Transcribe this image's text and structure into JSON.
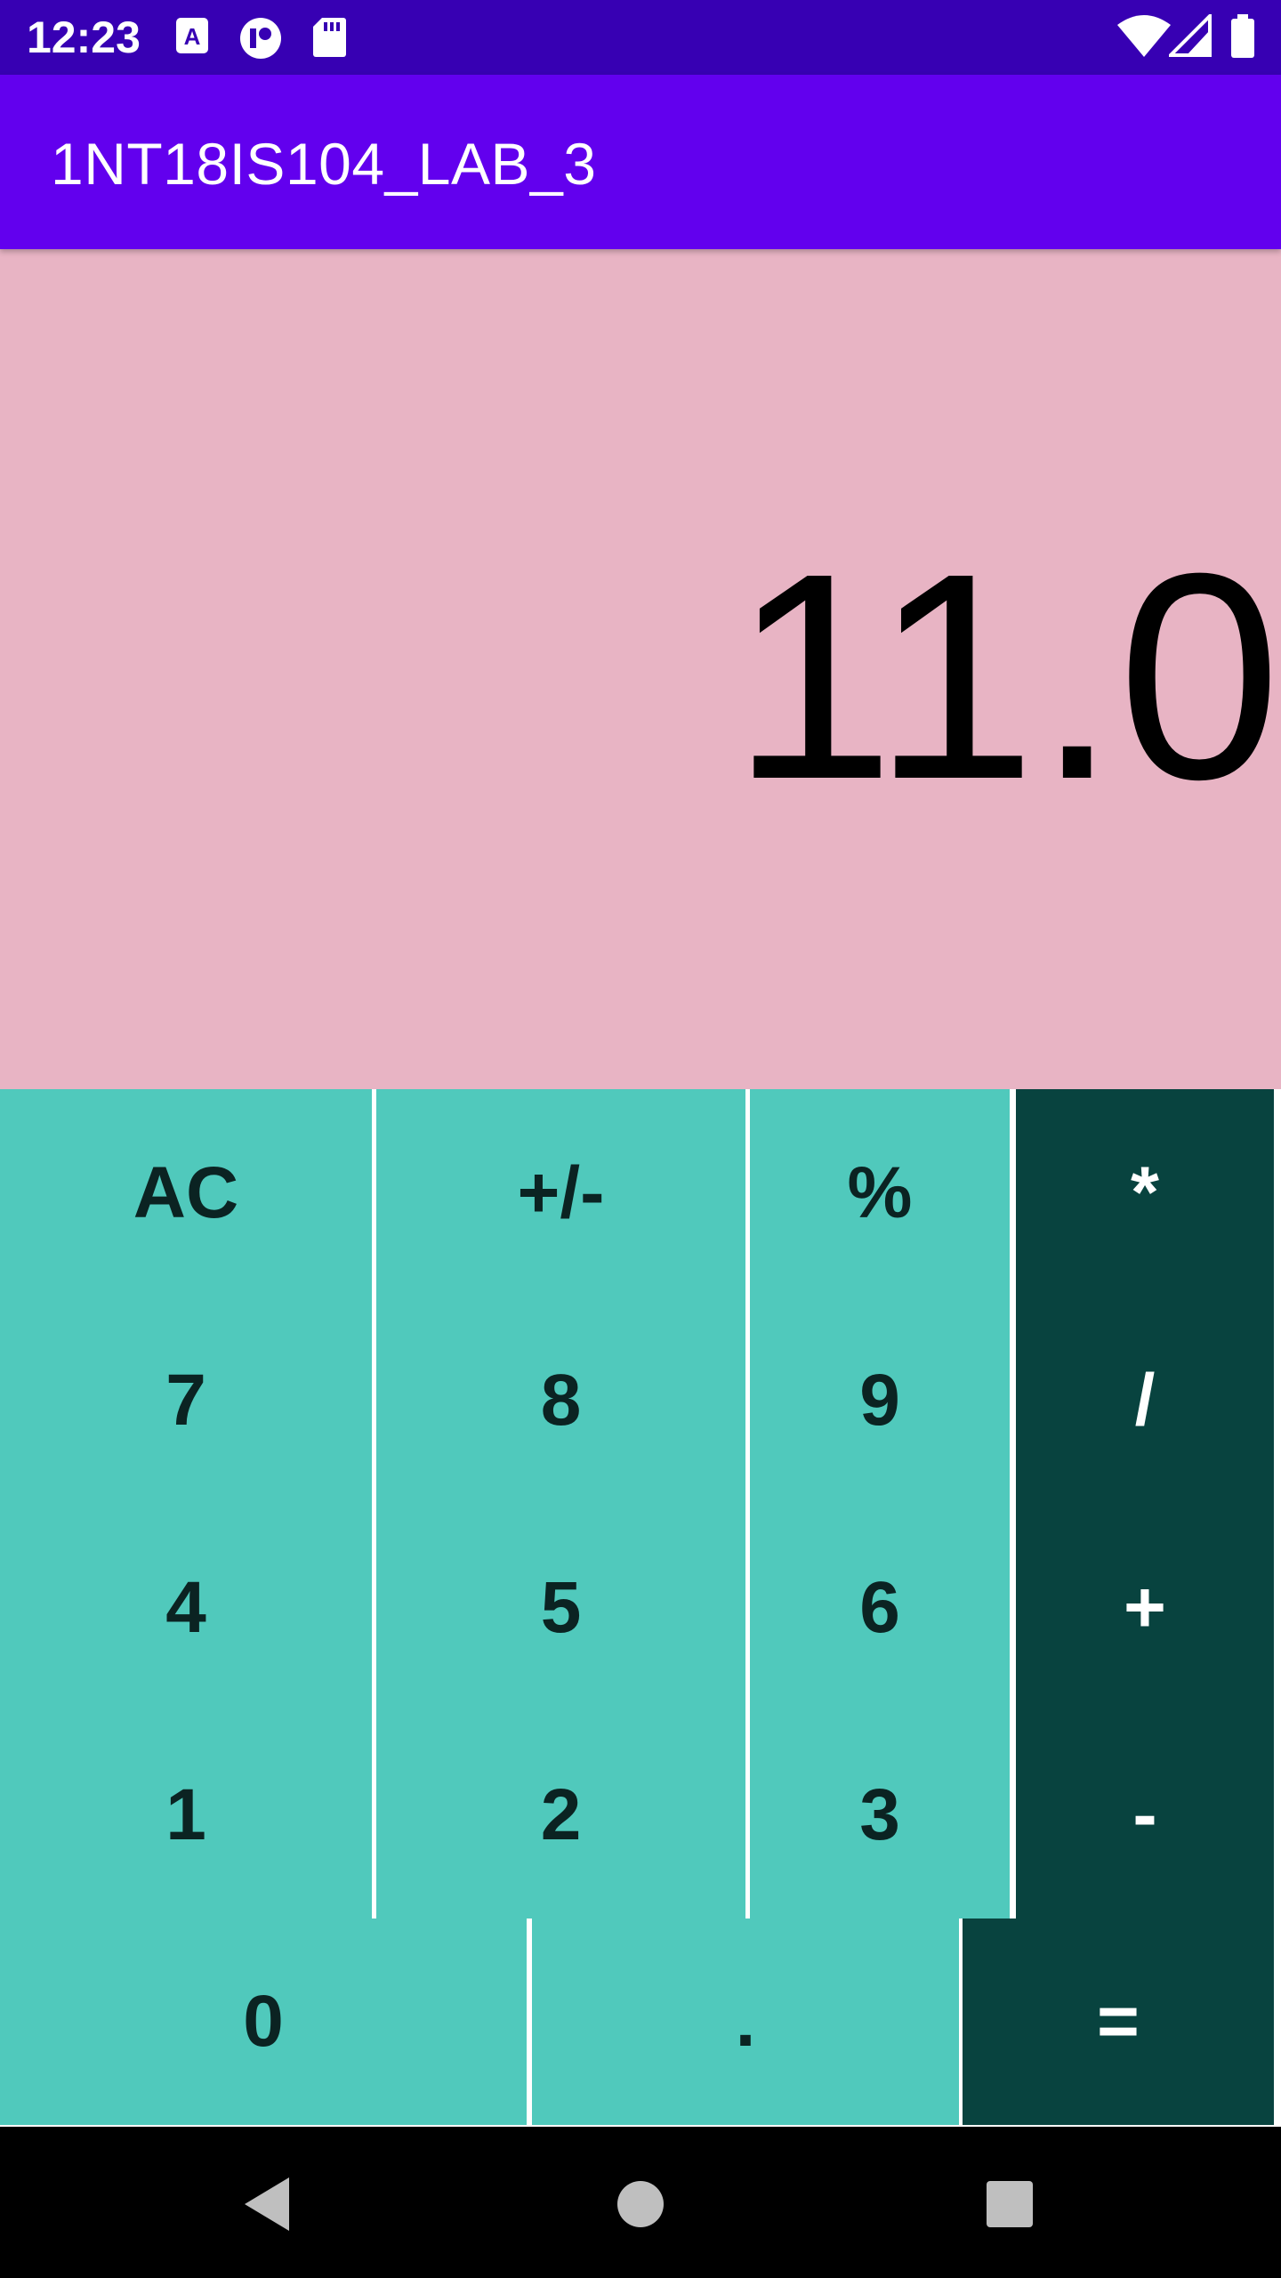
{
  "status_bar": {
    "time": "12:23",
    "left_icons": [
      "a-notification-icon",
      "circle-app-icon",
      "sd-card-icon"
    ],
    "right_icons": [
      "wifi-icon",
      "cell-signal-icon",
      "battery-icon"
    ]
  },
  "app_bar": {
    "title": "1NT18IS104_LAB_3"
  },
  "display": {
    "value": "11.0"
  },
  "keys": {
    "ac": "AC",
    "negate": "+/-",
    "percent": "%",
    "multiply": "*",
    "seven": "7",
    "eight": "8",
    "nine": "9",
    "divide": "/",
    "four": "4",
    "five": "5",
    "six": "6",
    "plus": "+",
    "one": "1",
    "two": "2",
    "three": "3",
    "minus": "-",
    "zero": "0",
    "decimal": ".",
    "equals": "="
  },
  "colors": {
    "status_bar": "#3700B3",
    "app_bar": "#6200EE",
    "display_bg": "#E8B4C4",
    "number_key_bg": "#50C9BC",
    "operator_key_bg": "#08433F"
  },
  "nav_bar": {
    "buttons": [
      "back-icon",
      "home-icon",
      "recents-icon"
    ]
  }
}
